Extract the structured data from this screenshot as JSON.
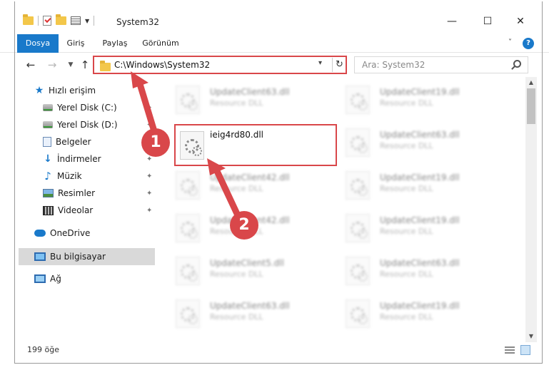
{
  "window": {
    "title": "System32",
    "controls": {
      "minimize": "—",
      "maximize": "☐",
      "close": "✕"
    }
  },
  "ribbon": {
    "tabs": [
      "Dosya",
      "Giriş",
      "Paylaş",
      "Görünüm"
    ],
    "help": "?"
  },
  "navigation": {
    "address": "C:\\Windows\\System32",
    "search_placeholder": "Ara: System32"
  },
  "sidebar": {
    "items": [
      {
        "label": "Hızlı erişim",
        "icon": "star-icon"
      },
      {
        "label": "Yerel Disk (C:)",
        "icon": "disk-icon",
        "pinned": true
      },
      {
        "label": "Yerel Disk (D:)",
        "icon": "disk-icon",
        "pinned": true
      },
      {
        "label": "Belgeler",
        "icon": "document-icon",
        "pinned": true
      },
      {
        "label": "İndirmeler",
        "icon": "download-icon",
        "pinned": true
      },
      {
        "label": "Müzik",
        "icon": "music-icon",
        "pinned": true
      },
      {
        "label": "Resimler",
        "icon": "pictures-icon",
        "pinned": true
      },
      {
        "label": "Videolar",
        "icon": "video-icon",
        "pinned": true
      },
      {
        "label": "OneDrive",
        "icon": "cloud-icon"
      },
      {
        "label": "Bu bilgisayar",
        "icon": "computer-icon",
        "selected": true
      },
      {
        "label": "Ağ",
        "icon": "network-icon"
      }
    ]
  },
  "files": {
    "highlighted": {
      "name": "ieig4rd80.dll"
    },
    "background": [
      {
        "name": "UpdateClient63.dll",
        "type": "Resource DLL"
      },
      {
        "name": "UpdateClient19.dll",
        "type": "Resource DLL"
      },
      {
        "name": "UpdateClient63.dll",
        "type": "Resource DLL"
      },
      {
        "name": "UpdateClient42.dll",
        "type": "Resource DLL"
      },
      {
        "name": "UpdateClient19.dll",
        "type": "Resource DLL"
      },
      {
        "name": "UpdateClient42.dll",
        "type": "Resource DLL"
      },
      {
        "name": "UpdateClient19.dll",
        "type": "Resource DLL"
      },
      {
        "name": "UpdateClient5.dll",
        "type": "Resource DLL"
      },
      {
        "name": "UpdateClient63.dll",
        "type": "Resource DLL"
      },
      {
        "name": "UpdateClient63.dll",
        "type": "Resource DLL"
      },
      {
        "name": "UpdateClient19.dll",
        "type": "Resource DLL"
      }
    ]
  },
  "status": {
    "item_count": "199 öğe"
  },
  "annotations": {
    "step1": "1",
    "step2": "2",
    "color": "#d9474a"
  }
}
